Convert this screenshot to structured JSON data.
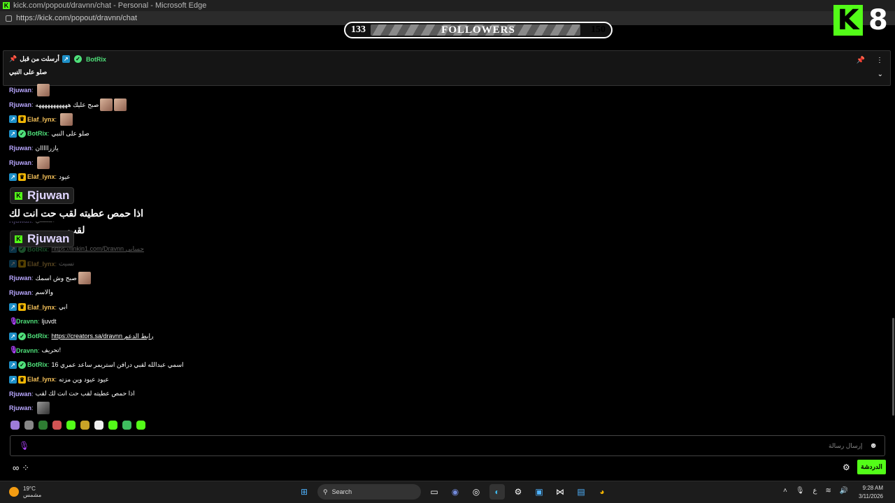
{
  "window": {
    "title": "kick.com/popout/dravnn/chat - Personal - Microsoft Edge",
    "url": "https://kick.com/popout/dravnn/chat"
  },
  "followers": {
    "current": "133",
    "label": "FOLLOWERS",
    "goal": "150",
    "progress": 0.886
  },
  "overlay_logo": {
    "number": "8"
  },
  "pinned": {
    "meta": "أرسلت من قبل",
    "user": "BotRix",
    "text": "صلو على النبي",
    "top_faded": "Elaf_lynx: "
  },
  "messages": [
    {
      "user": "Rjuwan",
      "color": "rj",
      "badges": [],
      "text": "",
      "emotes": 1
    },
    {
      "user": "Rjuwan",
      "color": "rj",
      "badges": [],
      "text": "صبح عليك هههههههههههه",
      "emotes": 2
    },
    {
      "user": "Elaf_lynx",
      "color": "el",
      "badges": [
        "mod",
        "crown"
      ],
      "text": "",
      "emotes": 1
    },
    {
      "user": "BotRix",
      "color": "bot",
      "badges": [
        "mod",
        "ver"
      ],
      "text": "صلو على النبي",
      "emotes": 0
    },
    {
      "user": "Rjuwan",
      "color": "rj",
      "badges": [],
      "text": "يازرااااان",
      "emotes": 0
    },
    {
      "user": "Rjuwan",
      "color": "rj",
      "badges": [],
      "text": "",
      "emotes": 1
    },
    {
      "user": "Elaf_lynx",
      "color": "el",
      "badges": [
        "mod",
        "crown"
      ],
      "text": "عيود",
      "emotes": 0
    },
    {
      "user": "",
      "color": "rj",
      "badges": [],
      "text": "",
      "emotes": 0
    },
    {
      "user": "",
      "color": "rj",
      "badges": [],
      "text": "",
      "emotes": 0
    },
    {
      "user": "Rjuwan",
      "color": "rj",
      "badges": [],
      "text": "اشتقتي",
      "emotes": 0,
      "dim": true
    },
    {
      "user": "",
      "color": "rj",
      "badges": [],
      "text": "",
      "emotes": 0
    },
    {
      "user": "BotRix",
      "color": "bot",
      "badges": [
        "mod",
        "ver"
      ],
      "text": "https://linkin1.com/Dravnn حسابي",
      "emotes": 0,
      "dim": true
    },
    {
      "user": "Elaf_lynx",
      "color": "el",
      "badges": [
        "mod",
        "crown"
      ],
      "text": "نسيت",
      "emotes": 0,
      "dim": true
    },
    {
      "user": "Rjuwan",
      "color": "rj",
      "badges": [],
      "text": "صبح وش اسمك",
      "emotes": 1
    },
    {
      "user": "Rjuwan",
      "color": "rj",
      "badges": [],
      "text": "والاسم",
      "emotes": 0
    },
    {
      "user": "Elaf_lynx",
      "color": "el",
      "badges": [
        "mod",
        "crown"
      ],
      "text": "ابي",
      "emotes": 0
    },
    {
      "user": "Dravnn",
      "color": "dr",
      "badges": [
        "mic"
      ],
      "text": "ljuvdt",
      "emotes": 0
    },
    {
      "user": "BotRix",
      "color": "bot",
      "badges": [
        "mod",
        "ver"
      ],
      "text": "https://creators.sa/dravnn رابط الدعم",
      "emotes": 0
    },
    {
      "user": "Dravnn",
      "color": "dr",
      "badges": [
        "mic"
      ],
      "text": "تحريف!",
      "emotes": 0
    },
    {
      "user": "BotRix",
      "color": "bot",
      "badges": [
        "mod",
        "ver"
      ],
      "text": "اسمي عبدالله لقبي درافن استريمر ساعد عمري 16",
      "emotes": 0
    },
    {
      "user": "Elaf_lynx",
      "color": "el",
      "badges": [
        "mod",
        "crown"
      ],
      "text": "عيود عيود وين مزته",
      "emotes": 0
    },
    {
      "user": "Rjuwan",
      "color": "rj",
      "badges": [],
      "text": "اذا حمص عطيته لقب حت انت لك لقب",
      "emotes": 0
    },
    {
      "user": "Rjuwan",
      "color": "rj",
      "badges": [],
      "text": "",
      "emotes": 1,
      "gray": true
    }
  ],
  "overlay_cards": [
    {
      "name": "Rjuwan"
    },
    {
      "name": "Rjuwan"
    }
  ],
  "overlay_text": "اذا حمص عطيته لقب حت انت لك لقب",
  "input": {
    "placeholder": "إرسال رسالة"
  },
  "chat_button": "الدردشة",
  "taskbar": {
    "temp": "19°C",
    "weather": "مشمس",
    "search": "Search",
    "time": "9:28 AM",
    "date": "3/11/2026",
    "lang": "ع"
  },
  "colors": {
    "kick_green": "#53fc18",
    "rj": "#b9a7ff",
    "el": "#f7c35a",
    "bot": "#4fe07a"
  }
}
